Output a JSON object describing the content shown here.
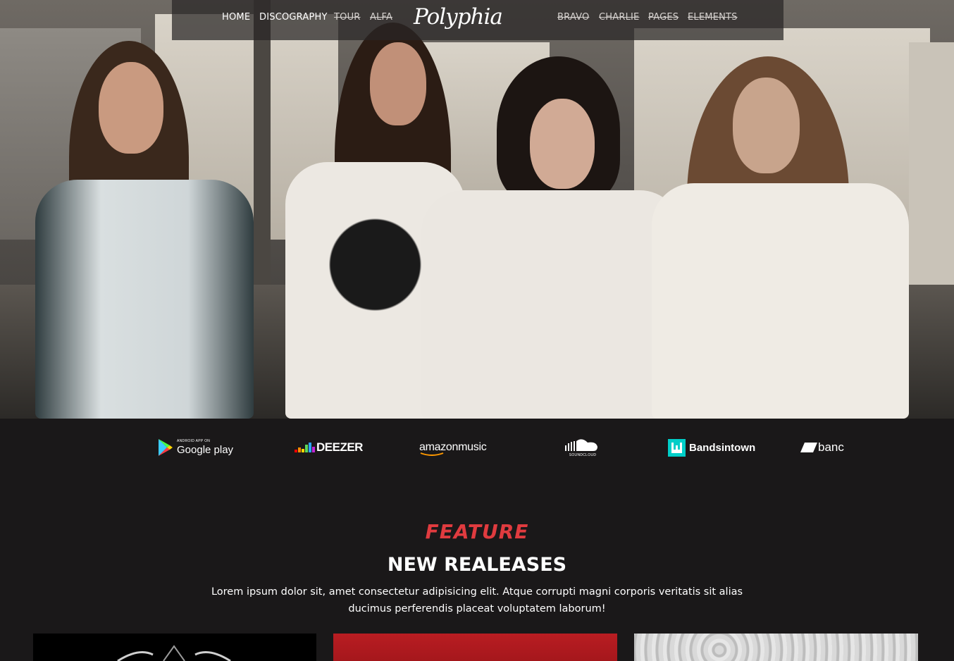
{
  "nav": {
    "left_items": [
      {
        "label": "HOME",
        "struck": false
      },
      {
        "label": "DISCOGRAPHY",
        "struck": false
      },
      {
        "label": "TOUR",
        "struck": true
      },
      {
        "label": "ALFA",
        "struck": true
      }
    ],
    "logo_text": "Polyphia",
    "right_items": [
      {
        "label": "BRAVO",
        "struck": true
      },
      {
        "label": "CHARLIE",
        "struck": true
      },
      {
        "label": "PAGES",
        "struck": true
      },
      {
        "label": "ELEMENTS",
        "struck": true
      }
    ]
  },
  "hero": {
    "image": "band-photo"
  },
  "platforms": [
    {
      "name": "Google play",
      "small": "ANDROID APP ON",
      "icon": "google-play-icon"
    },
    {
      "name": "DEEZER",
      "icon": "deezer-icon"
    },
    {
      "name": "amazonmusic",
      "icon": "amazon-music-icon"
    },
    {
      "name": "SOUNDCLOUD",
      "icon": "soundcloud-icon"
    },
    {
      "name": "Bandsintown",
      "icon": "bandsintown-icon"
    },
    {
      "name": "banc",
      "icon": "bandcamp-icon"
    }
  ],
  "feature": {
    "eyebrow": "FEATURE",
    "heading": "NEW REALEASES",
    "intro": "Lorem ipsum dolor sit, amet consectetur adipisicing elit. Atque corrupti magni corporis veritatis sit alias ducimus perferendis placeat voluptatem laborum!"
  },
  "colors": {
    "accent": "#e03b3f",
    "background": "#1a1819",
    "card_red": "#b91d22"
  }
}
